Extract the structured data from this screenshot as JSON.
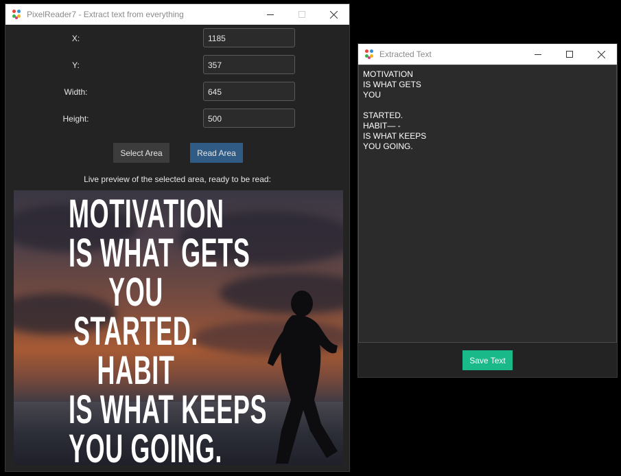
{
  "main_window": {
    "title": "PixelReader7 - Extract text from everything",
    "fields": [
      {
        "label": "X:",
        "value": "1185"
      },
      {
        "label": "Y:",
        "value": "357"
      },
      {
        "label": "Width:",
        "value": "645"
      },
      {
        "label": "Height:",
        "value": "500"
      }
    ],
    "select_button": "Select Area",
    "read_button": "Read Area",
    "preview_caption": "Live preview of the selected area, ready to be read:",
    "preview_lines": [
      "MOTIVATION",
      "IS WHAT GETS",
      "YOU",
      "STARTED.",
      "HABIT",
      "IS WHAT KEEPS",
      "YOU GOING."
    ]
  },
  "extract_window": {
    "title": "Extracted Text",
    "text": "MOTIVATION\nIS WHAT GETS\nYOU\n\nSTARTED.\nHABIT— -\nIS WHAT KEEPS\nYOU GOING.",
    "save_button": "Save Text"
  },
  "colors": {
    "select_button_bg": "#3c3c3c",
    "read_button_bg": "#2f5b85",
    "save_button_bg": "#19b98a"
  },
  "icons": [
    "app-icon",
    "minimize-icon",
    "maximize-icon",
    "close-icon",
    "runner-silhouette"
  ]
}
